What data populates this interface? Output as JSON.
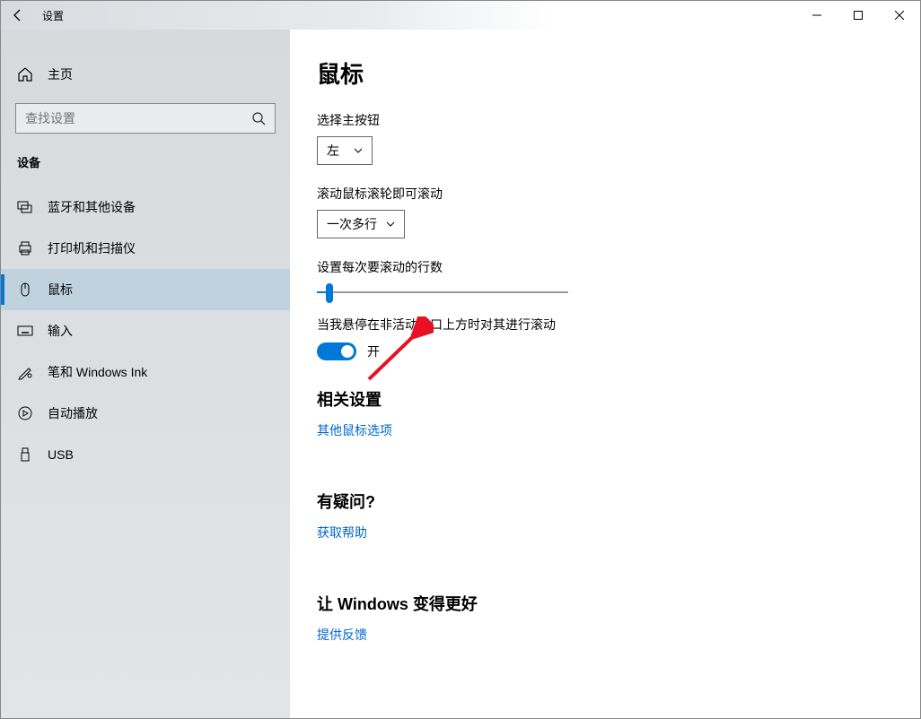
{
  "titlebar": {
    "title": "设置"
  },
  "sidebar": {
    "home_label": "主页",
    "search_placeholder": "查找设置",
    "section_label": "设备",
    "items": [
      {
        "id": "bluetooth",
        "label": "蓝牙和其他设备",
        "icon": "bluetooth-devices-icon"
      },
      {
        "id": "printers",
        "label": "打印机和扫描仪",
        "icon": "printer-icon"
      },
      {
        "id": "mouse",
        "label": "鼠标",
        "icon": "mouse-icon",
        "active": true
      },
      {
        "id": "typing",
        "label": "输入",
        "icon": "keyboard-icon"
      },
      {
        "id": "pen",
        "label": "笔和 Windows Ink",
        "icon": "pen-icon"
      },
      {
        "id": "autoplay",
        "label": "自动播放",
        "icon": "autoplay-icon"
      },
      {
        "id": "usb",
        "label": "USB",
        "icon": "usb-icon"
      }
    ]
  },
  "main": {
    "title": "鼠标",
    "primary_button_label": "选择主按钮",
    "primary_button_value": "左",
    "scroll_mode_label": "滚动鼠标滚轮即可滚动",
    "scroll_mode_value": "一次多行",
    "lines_label": "设置每次要滚动的行数",
    "hover_scroll_label": "当我悬停在非活动窗口上方时对其进行滚动",
    "toggle_on_label": "开",
    "related_section": "相关设置",
    "related_link": "其他鼠标选项",
    "help_section": "有疑问?",
    "help_link": "获取帮助",
    "feedback_section": "让 Windows 变得更好",
    "feedback_link": "提供反馈"
  }
}
